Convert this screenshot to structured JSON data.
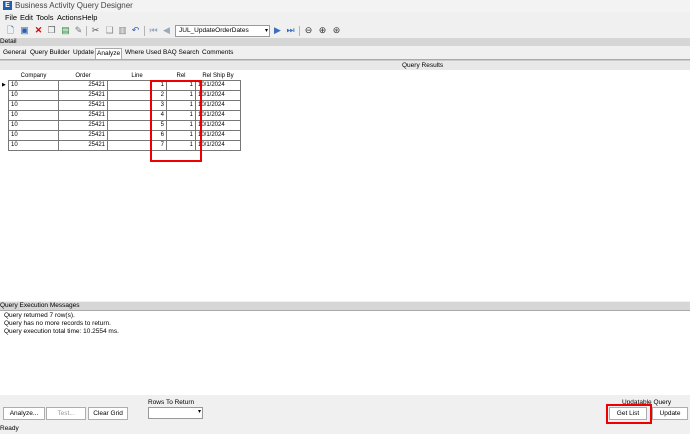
{
  "window": {
    "title": "Business Activity Query Designer",
    "app_icon": "E"
  },
  "menu": {
    "items": [
      "File",
      "Edit",
      "Tools",
      "Actions",
      "Help"
    ]
  },
  "toolbar": {
    "query_select": "JUL_UpdateOrderDates",
    "icons": [
      "new-icon",
      "save-icon",
      "delete-icon",
      "copy-icon",
      "export-icon",
      "clear-icon",
      "cut-icon",
      "copy2-icon",
      "paste-icon",
      "undo-icon",
      "first-icon",
      "prev-icon",
      "next-icon",
      "last-icon",
      "back-icon",
      "forward-icon",
      "refresh-icon"
    ]
  },
  "detail": {
    "label": "Detail"
  },
  "tabs": [
    "General",
    "Query Builder",
    "Update",
    "Analyze",
    "Where Used",
    "BAQ Search",
    "Comments"
  ],
  "active_tab": "Analyze",
  "results": {
    "title": "Query Results",
    "columns": [
      "Company",
      "Order",
      "Line",
      "Rel",
      "Rel Ship By"
    ],
    "rows": [
      [
        "10",
        "25421",
        "1",
        "1",
        "10/1/2024"
      ],
      [
        "10",
        "25421",
        "2",
        "1",
        "10/1/2024"
      ],
      [
        "10",
        "25421",
        "3",
        "1",
        "10/1/2024"
      ],
      [
        "10",
        "25421",
        "4",
        "1",
        "10/1/2024"
      ],
      [
        "10",
        "25421",
        "5",
        "1",
        "10/1/2024"
      ],
      [
        "10",
        "25421",
        "6",
        "1",
        "10/1/2024"
      ],
      [
        "10",
        "25421",
        "7",
        "1",
        "10/1/2024"
      ]
    ],
    "row_indicator": "▶"
  },
  "messages": {
    "title": "Query Execution Messages",
    "lines": [
      "Query returned 7 row(s).",
      "Query has no more records to return.",
      "Query execution total time: 10.2554 ms."
    ]
  },
  "controls": {
    "analyze_label": "Analyze...",
    "test_label": "Test...",
    "clear_grid_label": "Clear Grid",
    "rows_to_return_label": "Rows To Return",
    "rows_to_return_value": "",
    "updatable_query_label": "Updatable Query",
    "get_list_label": "Get List",
    "update_label": "Update"
  },
  "status": {
    "text": "Ready"
  },
  "colors": {
    "highlight": "#e00000",
    "accent": "#1f5fae"
  }
}
